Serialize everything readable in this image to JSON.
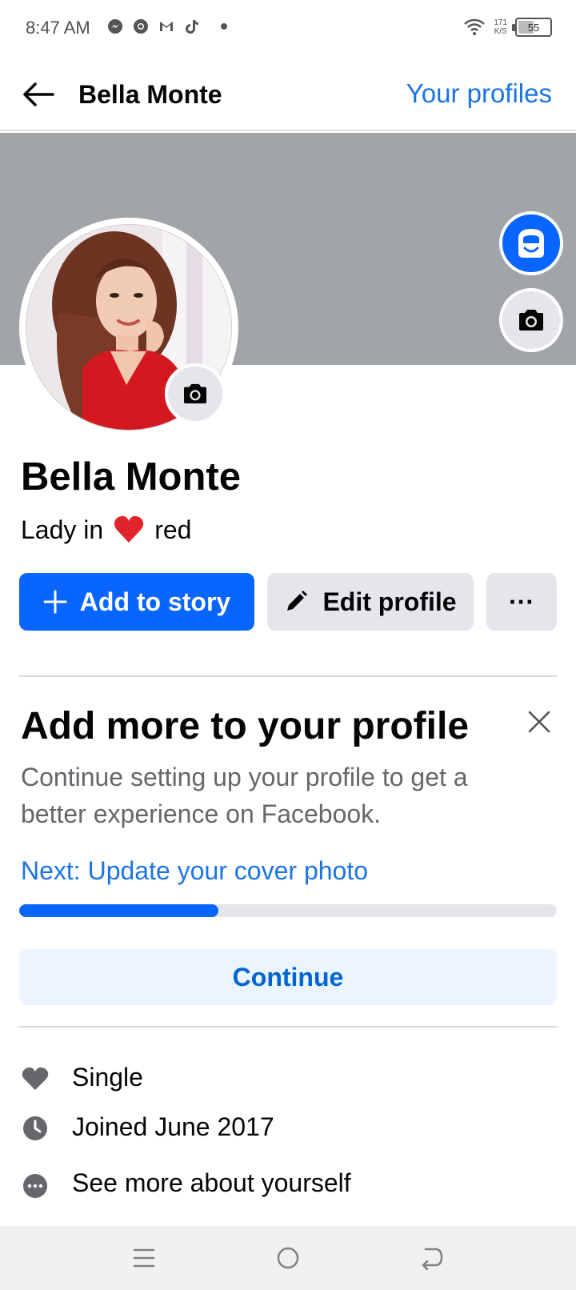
{
  "status_bar": {
    "time": "8:47 AM",
    "net_speed_value": "171",
    "net_speed_unit": "K/S",
    "battery": "55",
    "battery_level": 0.55,
    "notification_icons": [
      "messenger-icon",
      "chrome-icon",
      "gmail-icon",
      "tiktok-icon"
    ]
  },
  "header": {
    "title": "Bella Monte",
    "your_profiles": "Your profiles"
  },
  "profile": {
    "name": "Bella Monte",
    "bio_before": "Lady in",
    "bio_after": "red"
  },
  "actions": {
    "add_to_story": "Add to story",
    "edit_profile": "Edit profile",
    "more": "···"
  },
  "add_more": {
    "title": "Add more to your profile",
    "description": "Continue setting up your profile to get a better experience on Facebook.",
    "next": "Next: Update your cover photo",
    "progress": 0.37,
    "continue": "Continue"
  },
  "info": {
    "relationship": "Single",
    "joined": "Joined June 2017",
    "see_more": "See more about yourself"
  },
  "colors": {
    "accent": "#0866ff",
    "link": "#1b74e4",
    "cover": "#a1a4a8",
    "secondary_button": "#e4e6eb",
    "heart": "#e0242b"
  }
}
